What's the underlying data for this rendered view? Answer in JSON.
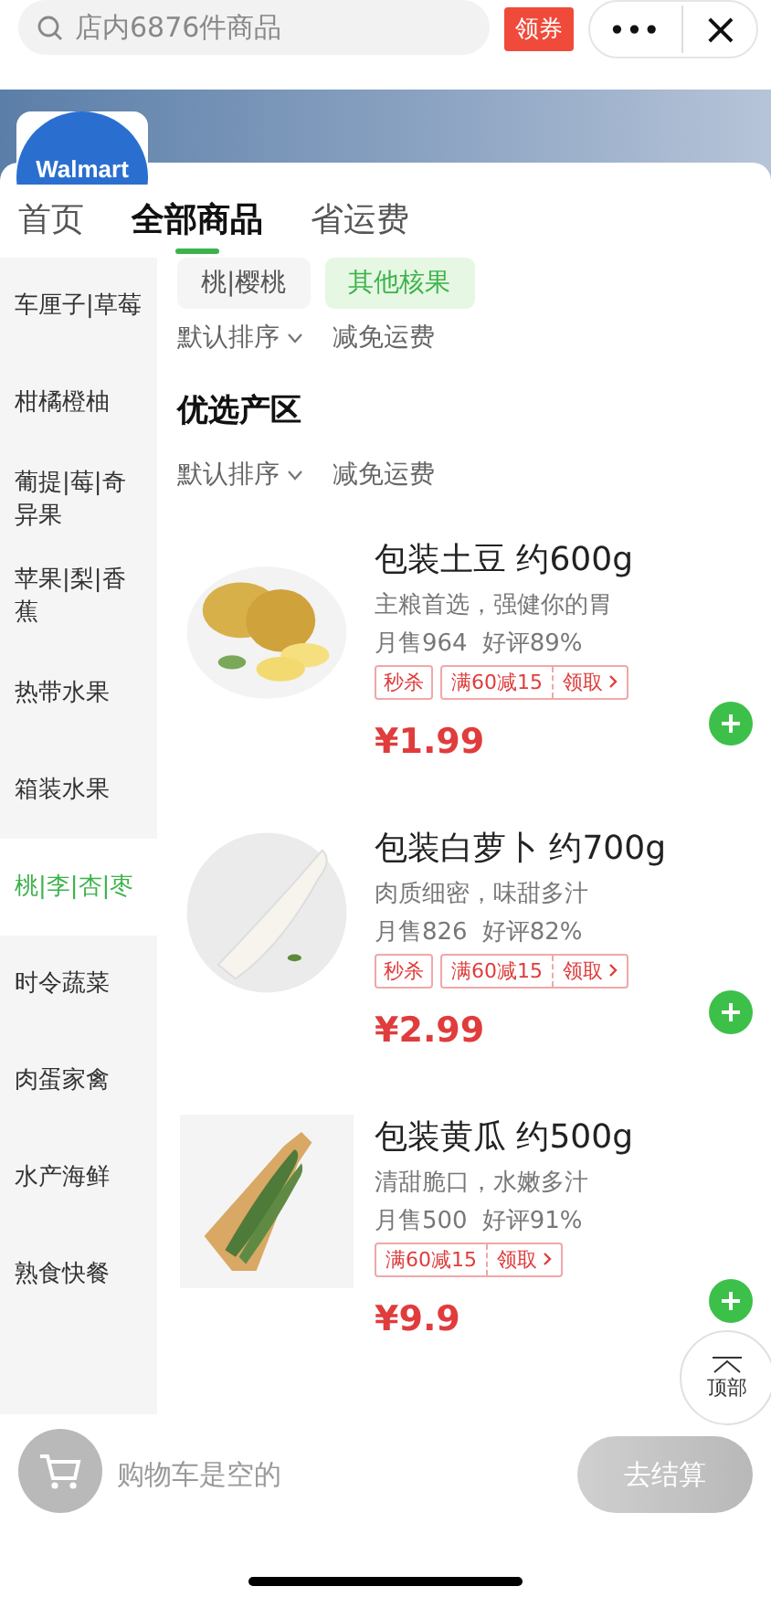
{
  "search": {
    "placeholder": "店内6876件商品"
  },
  "coupon_badge": "领券",
  "capsule": {
    "more": "•••",
    "close": "×"
  },
  "store": {
    "logo_text": "Walmart"
  },
  "tabs": [
    {
      "label": "首页",
      "selected": false
    },
    {
      "label": "全部商品",
      "selected": true
    },
    {
      "label": "省运费",
      "selected": false
    }
  ],
  "sidebar": {
    "items": [
      {
        "label": "车厘子|草莓",
        "selected": false
      },
      {
        "label": "柑橘橙柚",
        "selected": false
      },
      {
        "label": "葡提|莓|奇异果",
        "selected": false
      },
      {
        "label": "苹果|梨|香蕉",
        "selected": false
      },
      {
        "label": "热带水果",
        "selected": false
      },
      {
        "label": "箱装水果",
        "selected": false
      },
      {
        "label": "桃|李|杏|枣",
        "selected": true
      },
      {
        "label": "时令蔬菜",
        "selected": false
      },
      {
        "label": "肉蛋家禽",
        "selected": false
      },
      {
        "label": "水产海鲜",
        "selected": false
      },
      {
        "label": "熟食快餐",
        "selected": false
      }
    ]
  },
  "subcategories": [
    {
      "label": "桃|樱桃",
      "selected": false
    },
    {
      "label": "其他核果",
      "selected": true
    }
  ],
  "sort_rows": [
    {
      "sort": "默认排序",
      "filter": "减免运费"
    },
    {
      "sort": "默认排序",
      "filter": "减免运费"
    }
  ],
  "section_title": "优选产区",
  "products": [
    {
      "kind": "potato",
      "name": "包装土豆 约600g",
      "desc": "主粮首选，强健你的胃",
      "sales": "月售964",
      "rating": "好评89%",
      "flash": "秒杀",
      "coupon": "满60减15",
      "claim": "领取",
      "price": "¥1.99"
    },
    {
      "kind": "radish",
      "name": "包装白萝卜 约700g",
      "desc": "肉质细密，味甜多汁",
      "sales": "月售826",
      "rating": "好评82%",
      "flash": "秒杀",
      "coupon": "满60减15",
      "claim": "领取",
      "price": "¥2.99"
    },
    {
      "kind": "cucumber",
      "name": "包装黄瓜 约500g",
      "desc": "清甜脆口，水嫩多汁",
      "sales": "月售500",
      "rating": "好评91%",
      "coupon": "满60减15",
      "claim": "领取",
      "price": "¥9.9"
    }
  ],
  "back_to_top": "顶部",
  "cart": {
    "status": "购物车是空的",
    "checkout": "去结算"
  }
}
